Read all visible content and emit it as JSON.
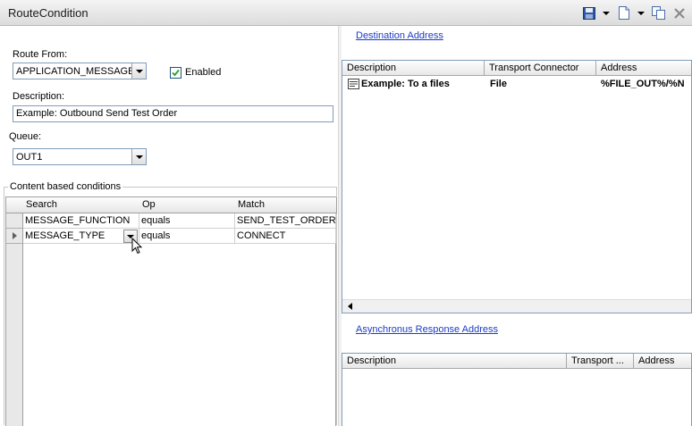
{
  "window": {
    "title": "RouteCondition"
  },
  "toolbar": {
    "icons": [
      "save-icon",
      "dropdown-arrow-icon",
      "new-document-icon",
      "dropdown-arrow-icon",
      "copy-icon",
      "close-icon"
    ]
  },
  "form": {
    "route_from_label": "Route From:",
    "route_from_value": "APPLICATION_MESSAGE",
    "enabled_label": "Enabled",
    "enabled_checked": true,
    "description_label": "Description:",
    "description_value": "Example: Outbound Send Test Order",
    "queue_label": "Queue:",
    "queue_value": "OUT1"
  },
  "conditions": {
    "group_title": "Content based conditions",
    "columns": [
      "Search",
      "Op",
      "Match"
    ],
    "rows": [
      {
        "search": "MESSAGE_FUNCTION",
        "op": "equals",
        "match": "SEND_TEST_ORDER"
      },
      {
        "search": "MESSAGE_TYPE",
        "op": "equals",
        "match": "CONNECT"
      }
    ]
  },
  "destination": {
    "link_label": "Destination Address",
    "columns": [
      "Description",
      "Transport Connector",
      "Address"
    ],
    "rows": [
      {
        "icon": "file-icon",
        "description": "Example: To a files",
        "connector": "File",
        "address": "%FILE_OUT%/%N"
      }
    ]
  },
  "async_response": {
    "link_label": "Asynchronus Response Address",
    "columns": [
      "Description",
      "Transport ...",
      "Address"
    ]
  }
}
